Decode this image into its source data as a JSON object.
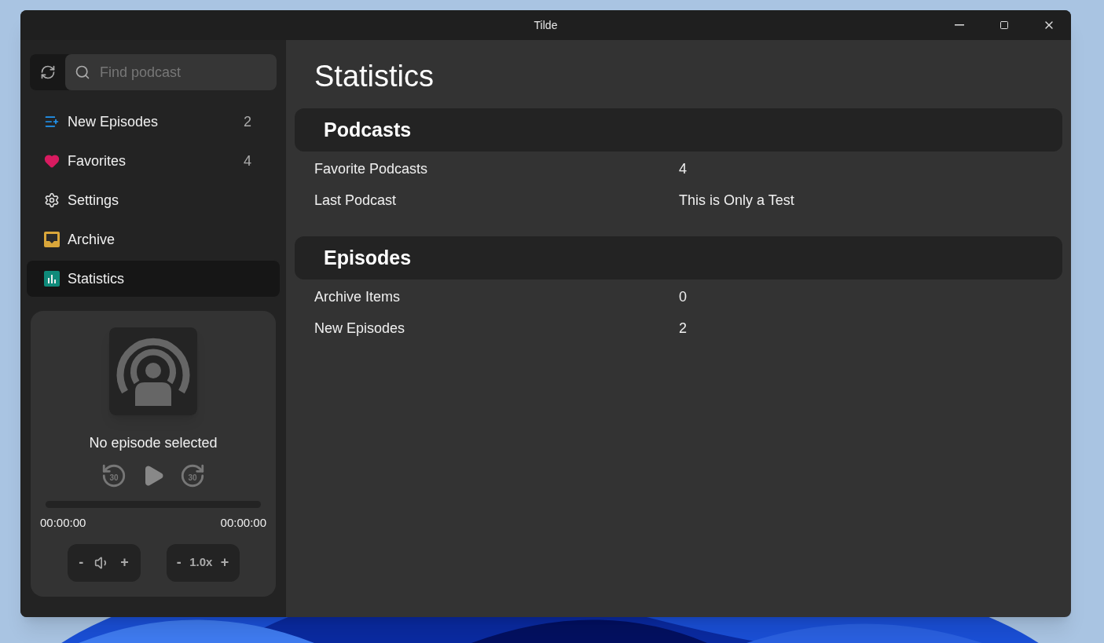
{
  "window": {
    "title": "Tilde"
  },
  "sidebar": {
    "search": {
      "placeholder": "Find podcast"
    },
    "items": [
      {
        "label": "New Episodes",
        "count": "2",
        "kind": "new",
        "selected": false
      },
      {
        "label": "Favorites",
        "count": "4",
        "kind": "favorites",
        "selected": false
      },
      {
        "label": "Settings",
        "kind": "settings",
        "selected": false
      },
      {
        "label": "Archive",
        "kind": "archive",
        "selected": false
      },
      {
        "label": "Statistics",
        "kind": "statistics",
        "selected": true
      }
    ]
  },
  "player": {
    "status": "No episode selected",
    "skip_back": "30",
    "skip_forward": "30",
    "elapsed": "00:00:00",
    "total": "00:00:00",
    "volume": {
      "minus": "-",
      "plus": "+"
    },
    "speed": {
      "minus": "-",
      "value": "1.0x",
      "plus": "+"
    }
  },
  "main": {
    "title": "Statistics",
    "sections": [
      {
        "heading": "Podcasts",
        "rows": [
          {
            "label": "Favorite Podcasts",
            "value": "4"
          },
          {
            "label": "Last Podcast",
            "value": "This is Only a Test"
          }
        ]
      },
      {
        "heading": "Episodes",
        "rows": [
          {
            "label": "Archive Items",
            "value": "0"
          },
          {
            "label": "New Episodes",
            "value": "2"
          }
        ]
      }
    ]
  }
}
